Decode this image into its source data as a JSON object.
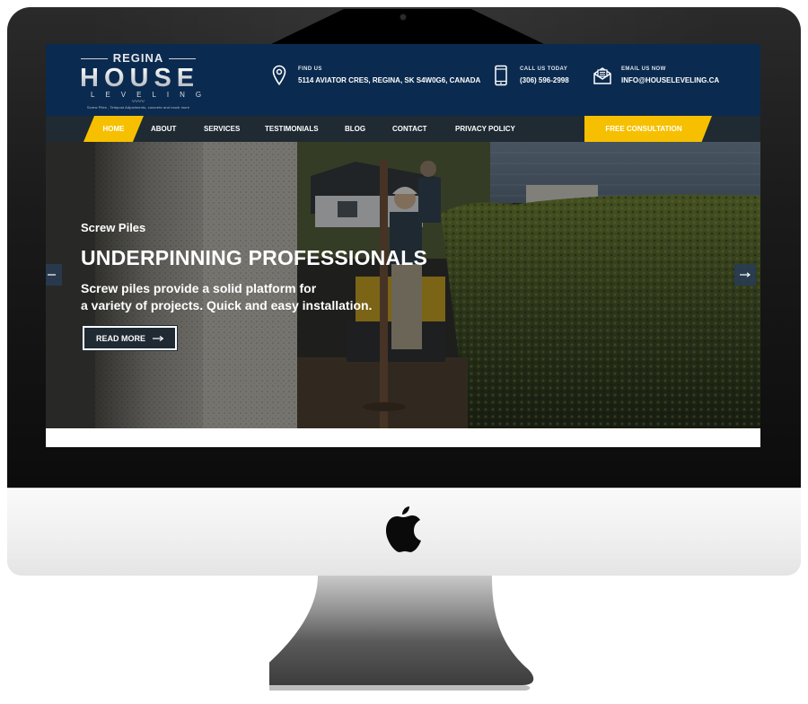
{
  "device": {
    "type": "iMac",
    "brand_icon": "apple-logo-icon"
  },
  "site": {
    "logo": {
      "line1": "REGINA",
      "line2": "HOUSE",
      "line3": "LEVELING",
      "tagline": "Screw Piles , Telepost Adjustments, concrete and much more"
    },
    "contacts": [
      {
        "icon": "map-pin-icon",
        "label": "FIND US",
        "value": "5114 AVIATOR CRES, REGINA, SK S4W0G6, CANADA"
      },
      {
        "icon": "phone-icon",
        "label": "CALL US TODAY",
        "value": "(306) 596-2998"
      },
      {
        "icon": "email-icon",
        "label": "EMAIL US NOW",
        "value": "INFO@HOUSELEVELING.CA"
      }
    ],
    "nav": {
      "items": [
        "HOME",
        "ABOUT",
        "SERVICES",
        "TESTIMONIALS",
        "BLOG",
        "CONTACT",
        "PRIVACY POLICY"
      ],
      "active": "HOME",
      "cta": "FREE CONSULTATION"
    },
    "hero": {
      "subtitle": "Screw Piles",
      "title": "UNDERPINNING PROFESSIONALS",
      "description_line1": "Screw piles provide a solid platform for",
      "description_line2": "a variety of projects. Quick and easy installation.",
      "button": "READ MORE",
      "button_icon": "arrow-right-icon",
      "prev_icon": "arrow-left-icon",
      "next_icon": "arrow-right-icon"
    },
    "colors": {
      "header_bg": "#0b2a4f",
      "nav_bg": "#1f2a33",
      "accent": "#f6c000"
    }
  }
}
